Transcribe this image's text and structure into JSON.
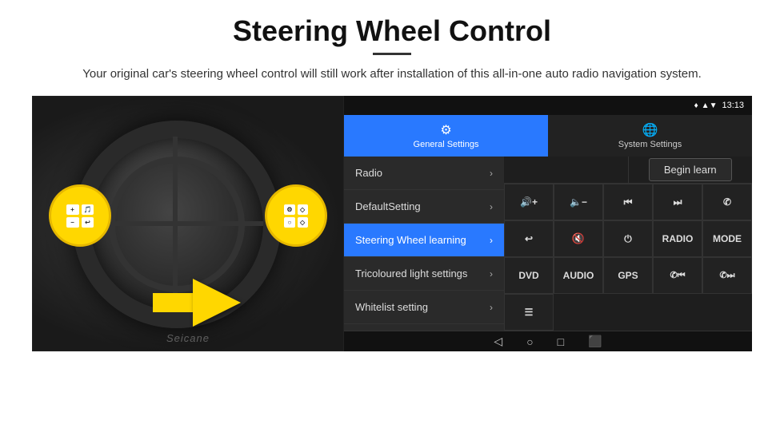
{
  "header": {
    "title": "Steering Wheel Control",
    "subtitle": "Your original car's steering wheel control will still work after installation of this all-in-one auto radio navigation system."
  },
  "head_unit": {
    "status_bar": {
      "time": "13:13",
      "signal_icon": "▲▲",
      "wifi_icon": "▼",
      "location_icon": "♦"
    },
    "tabs": [
      {
        "id": "general",
        "label": "General Settings",
        "icon": "⚙",
        "active": true
      },
      {
        "id": "system",
        "label": "System Settings",
        "icon": "🌐",
        "active": false
      }
    ],
    "menu_items": [
      {
        "id": "radio",
        "label": "Radio",
        "active": false
      },
      {
        "id": "default",
        "label": "DefaultSetting",
        "active": false
      },
      {
        "id": "steering",
        "label": "Steering Wheel learning",
        "active": true
      },
      {
        "id": "tricoloured",
        "label": "Tricoloured light settings",
        "active": false
      },
      {
        "id": "whitelist",
        "label": "Whitelist setting",
        "active": false
      }
    ],
    "begin_learn_label": "Begin learn",
    "control_buttons_row2": [
      {
        "id": "vol-up",
        "icon": "🔊+",
        "label": "🔊+"
      },
      {
        "id": "vol-down",
        "icon": "🔈-",
        "label": "🔈−"
      },
      {
        "id": "prev-track",
        "icon": "⏮",
        "label": "⏮"
      },
      {
        "id": "next-track",
        "icon": "⏭",
        "label": "⏭"
      },
      {
        "id": "phone",
        "icon": "📞",
        "label": "✆"
      }
    ],
    "control_buttons_row3": [
      {
        "id": "call-end",
        "icon": "↩",
        "label": "↩"
      },
      {
        "id": "mute",
        "icon": "🔇",
        "label": "🔇"
      },
      {
        "id": "power",
        "icon": "⏻",
        "label": "⏻"
      },
      {
        "id": "radio-btn",
        "label": "RADIO"
      },
      {
        "id": "mode-btn",
        "label": "MODE"
      }
    ],
    "control_buttons_row4": [
      {
        "id": "dvd",
        "label": "DVD"
      },
      {
        "id": "audio",
        "label": "AUDIO"
      },
      {
        "id": "gps",
        "label": "GPS"
      },
      {
        "id": "phone2",
        "icon": "📞⏮",
        "label": "✆⏮"
      },
      {
        "id": "phone3",
        "icon": "📞⏭",
        "label": "✆⏭"
      }
    ],
    "control_buttons_row5": [
      {
        "id": "list",
        "label": "☰"
      }
    ],
    "nav_buttons": [
      "◁",
      "○",
      "□",
      "⬛"
    ]
  },
  "watermark": "Seicane"
}
